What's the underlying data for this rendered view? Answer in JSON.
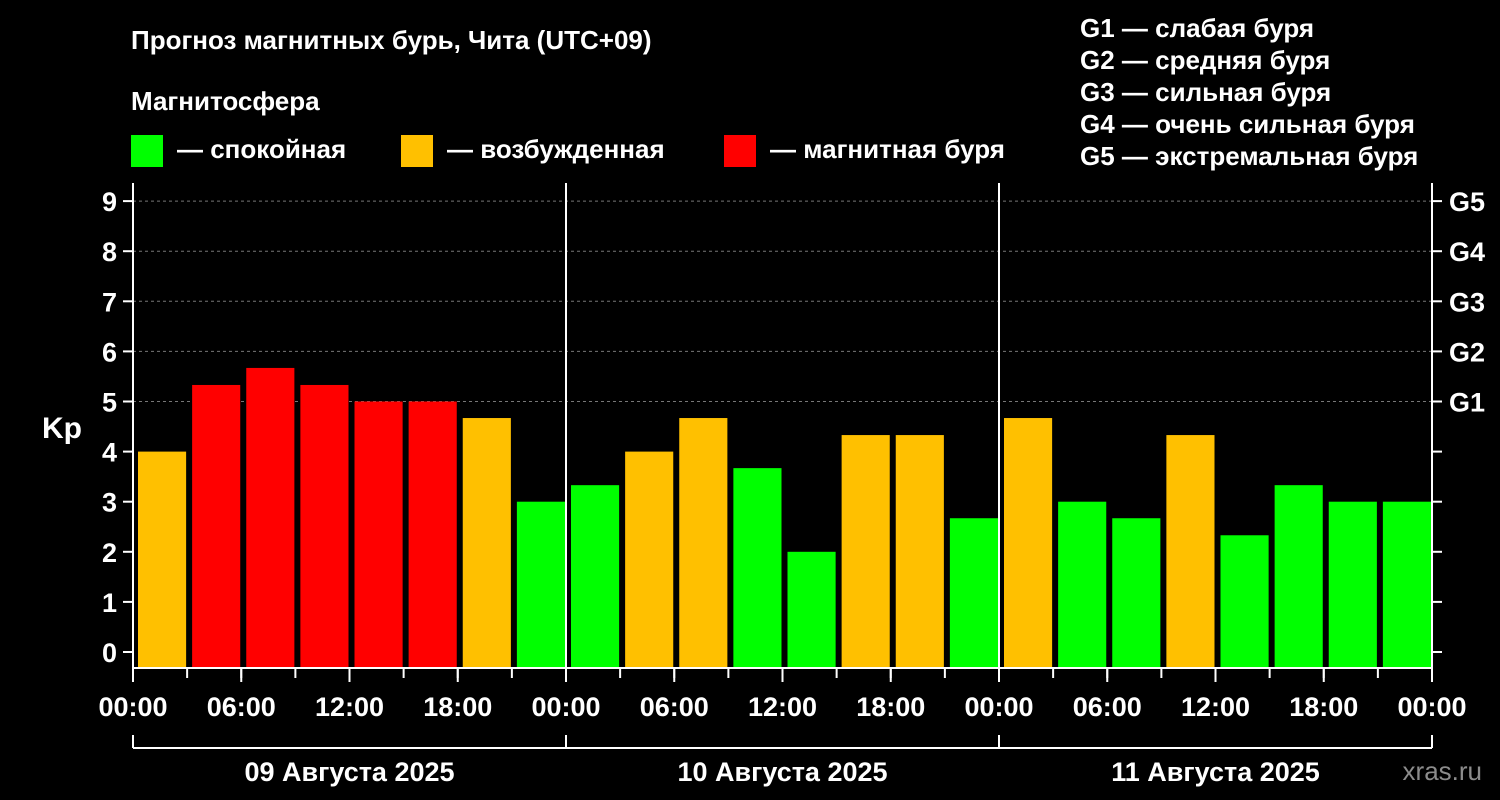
{
  "title": "Прогноз магнитных бурь, Чита (UTC+09)",
  "legend_title": "Магнитосфера",
  "legend": [
    {
      "label": "— спокойная",
      "color": "#00ff00"
    },
    {
      "label": "— возбужденная",
      "color": "#ffc000"
    },
    {
      "label": "— магнитная буря",
      "color": "#ff0000"
    }
  ],
  "g_scale": [
    "G1 — слабая буря",
    "G2 — средняя буря",
    "G3 — сильная буря",
    "G4 — очень сильная буря",
    "G5 — экстремальная буря"
  ],
  "watermark": "xras.ru",
  "chart_data": {
    "type": "bar",
    "ylabel": "Kp",
    "ylim": [
      0,
      9
    ],
    "yticks": [
      0,
      1,
      2,
      3,
      4,
      5,
      6,
      7,
      8,
      9
    ],
    "right_axis_labels": [
      {
        "value": 5,
        "label": "G1"
      },
      {
        "value": 6,
        "label": "G2"
      },
      {
        "value": 7,
        "label": "G3"
      },
      {
        "value": 8,
        "label": "G4"
      },
      {
        "value": 9,
        "label": "G5"
      }
    ],
    "grid": true,
    "days": [
      "09 Августа 2025",
      "10 Августа 2025",
      "11 Августа 2025"
    ],
    "x_tick_labels": [
      "00:00",
      "06:00",
      "12:00",
      "18:00",
      "00:00",
      "06:00",
      "12:00",
      "18:00",
      "00:00",
      "06:00",
      "12:00",
      "18:00",
      "00:00"
    ],
    "bar_interval_hours": 3,
    "values": [
      4.0,
      5.33,
      5.67,
      5.33,
      5.0,
      5.0,
      4.67,
      3.0,
      3.33,
      4.0,
      4.67,
      3.67,
      2.0,
      4.33,
      4.33,
      2.67,
      4.67,
      3.0,
      2.67,
      4.33,
      2.33,
      3.33,
      3.0,
      3.0
    ],
    "levels": [
      "excited",
      "storm",
      "storm",
      "storm",
      "storm",
      "storm",
      "excited",
      "quiet",
      "quiet",
      "excited",
      "excited",
      "quiet",
      "quiet",
      "excited",
      "excited",
      "quiet",
      "excited",
      "quiet",
      "quiet",
      "excited",
      "quiet",
      "quiet",
      "quiet",
      "quiet"
    ],
    "level_colors": {
      "quiet": "#00ff00",
      "excited": "#ffc000",
      "storm": "#ff0000"
    }
  }
}
